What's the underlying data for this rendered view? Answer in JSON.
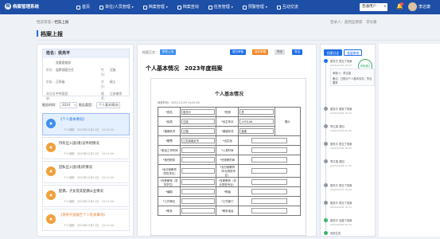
{
  "app": {
    "title": "档案管理系统"
  },
  "nav": [
    {
      "label": "首页",
      "active": false
    },
    {
      "label": "单位/人员管理",
      "active": false
    },
    {
      "label": "档案管理",
      "active": false
    },
    {
      "label": "档案查询",
      "active": false
    },
    {
      "label": "任务管理",
      "active": false
    },
    {
      "label": "预警管理",
      "active": false
    },
    {
      "label": "互动交流",
      "active": false
    }
  ],
  "header": {
    "role": "普通用户",
    "user": "李达康"
  },
  "breadcrumb": {
    "parent": "档案管理",
    "current": "档案上报"
  },
  "login_info": "登录人：超档监察部　李达康",
  "page_title": "档案上报",
  "profile": {
    "name_label": "姓名：",
    "name": "侯亮平",
    "rows": [
      {
        "k": "",
        "v": "党委督查部",
        "k2": "",
        "v2": ""
      },
      {
        "k": "职务：",
        "v": "监察部副主任",
        "k2": "性别：",
        "v2": "汉族"
      },
      {
        "k": "职级：",
        "v": "正科级",
        "k2": "学历：",
        "v2": "硕士"
      },
      {
        "k": "政治面貌：",
        "v": "中共党员",
        "k2": "籍贯：",
        "v2": "江苏南京"
      }
    ]
  },
  "filters": {
    "year_label": "报告时间：",
    "year": "2024",
    "cat_label": "报告类型：",
    "cat": "个人基本情况"
  },
  "items": [
    {
      "badge": "▣",
      "color": "#3f8ff0",
      "title": "《个人基本情况》",
      "who": "个人填报",
      "time": "2023年12月11日　10:11:24",
      "active": true,
      "hl": false
    },
    {
      "badge": "▣",
      "color": "#f0a03a",
      "title": "持有出入国(境)证件的情况",
      "who": "个人填报",
      "time": "2023年12月11日　10:11:24",
      "active": false,
      "hl": false
    },
    {
      "badge": "▣",
      "color": "#f0a03a",
      "title": "因私出入国(境)的情况",
      "who": "个人填报",
      "time": "2023年12月11日　10:11:24",
      "active": false,
      "hl": false
    },
    {
      "badge": "▣",
      "color": "#f0a03a",
      "title": "配偶、子女及其配偶从业情况",
      "who": "个人填报",
      "time": "2023年12月11日　10:11:24",
      "active": false,
      "hl": false
    },
    {
      "badge": "▣",
      "color": "#f0a03a",
      "title": "《领导干部报告个人有关事项》",
      "who": "个人填报",
      "time": "2023年12月11日　10:11:24",
      "active": false,
      "hl": true
    }
  ],
  "center": {
    "tool_label": "档案正文：",
    "buttons": [
      {
        "label": "附件上传",
        "color": "#3f8ff0"
      },
      {
        "label": "提交审核",
        "color": "#1e6fe8"
      },
      {
        "label": "保存草稿",
        "color": "#f08a2c"
      },
      {
        "label": "预览",
        "color": "#c9ced6"
      },
      {
        "label": "导出",
        "color": "#1e6fe8"
      }
    ],
    "doc_heading": "个人基本情况　2023年度档案",
    "paper_title": "个人基本情况",
    "paper_date": "填报时间：2023-12-09 14:02:00"
  },
  "form": {
    "r1": {
      "a": "*姓名",
      "b": "侯亮平",
      "c": "*性别",
      "d": "男"
    },
    "r2": {
      "a": "*民族",
      "b": "汉族",
      "c": "*出生年月",
      "d": "1978-06",
      "e": "照片"
    },
    "r3": {
      "a": "*婚姻状况",
      "b": "已婚",
      "c": "*健康状况",
      "d": "健康"
    },
    "r4": {
      "a": "*籍贯",
      "b": "江苏省南京市",
      "c": "*出生地",
      "d": ""
    },
    "r5": {
      "a": "*参加工作时间",
      "b": "",
      "c": "*入党时间",
      "d": ""
    },
    "r6": {
      "a": "*现任职务",
      "b": "",
      "c": "*任现职时间",
      "d": ""
    },
    "r7": {
      "a": "*全日制教育（学历学位）",
      "b": "",
      "c": "*全日制教育（毕业院校专业）",
      "d": ""
    },
    "r8": {
      "a": "*在职教育（学历学位）",
      "b": "",
      "c": "*在职教育（毕业院校专业）",
      "d": ""
    },
    "r9": {
      "a": "*编制",
      "b": "",
      "c": "*职级",
      "d": ""
    },
    "r10": {
      "a": "*工作单位",
      "b": "",
      "c": "*工作部门",
      "d": ""
    },
    "r11": {
      "a": "*职务",
      "b": "",
      "c": "*联系电话",
      "d": ""
    }
  },
  "right": {
    "tabs": [
      {
        "label": "档案日志",
        "on": true
      },
      {
        "label": "批量审核",
        "on": false
      }
    ],
    "stamp": "审核通过",
    "log": [
      {
        "text": "侯亮平 提交了档案",
        "time": "2023/12/10 10:22"
      },
      {
        "text": "审核人：李达康",
        "time": ""
      },
      {
        "text": "备注：已核对个人基本情况，符合要求",
        "time": ""
      },
      {
        "text": "侯亮平 更新了档案",
        "time": "2023/12/09 10:22"
      },
      {
        "text": "李达康 退回",
        "time": "2023/12/09 09:40"
      },
      {
        "text": "侯亮平 提交了档案",
        "time": "2023/12/08 16:02"
      },
      {
        "text": "李达康 退回",
        "time": "2023/12/08 11:20"
      },
      {
        "text": "侯亮平 提交了档案",
        "time": "2023/12/07 15:04"
      },
      {
        "text": "侯亮平 提交了档案",
        "time": "2023/12/06 10:11"
      },
      {
        "text": "侯亮平 创建了档案",
        "time": "2023/12/05 09:30"
      },
      {
        "text": "系统生成",
        "time": ""
      }
    ]
  }
}
